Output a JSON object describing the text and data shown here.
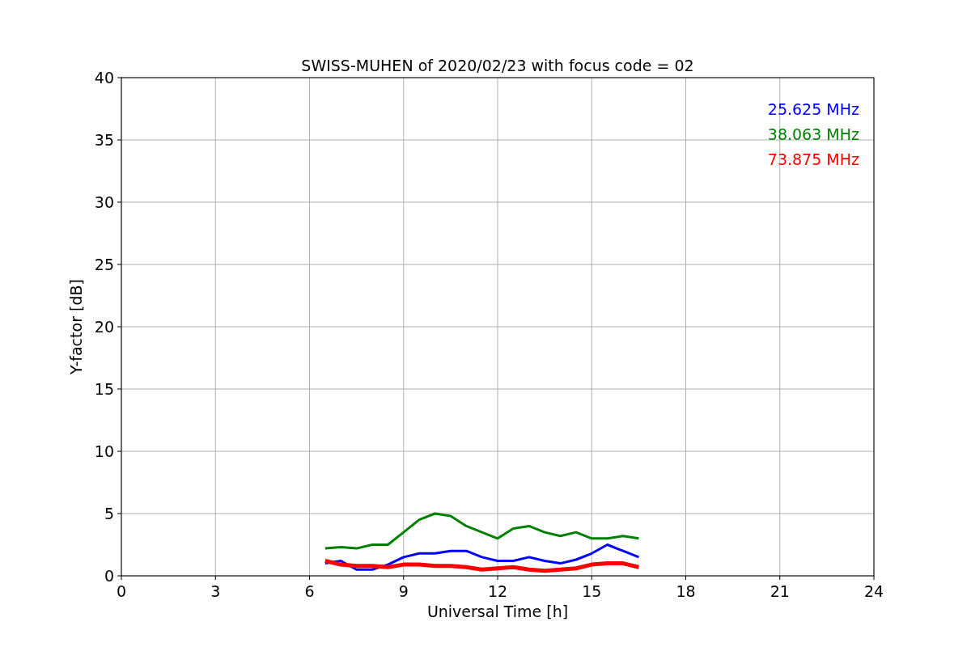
{
  "figure": {
    "chart_data": {
      "type": "line",
      "title": "SWISS-MUHEN of 2020/02/23 with focus code = 02",
      "xlabel": "Universal Time [h]",
      "ylabel": "Y-factor [dB]",
      "x": [
        6.5,
        7,
        7.5,
        8,
        8.5,
        9,
        9.5,
        10,
        10.5,
        11,
        11.5,
        12,
        12.5,
        13,
        13.5,
        14,
        14.5,
        15,
        15.5,
        16,
        16.5
      ],
      "series": [
        {
          "name": "25.625 MHz",
          "color": "#0000ff",
          "values": [
            1.0,
            1.2,
            0.5,
            0.5,
            0.9,
            1.5,
            1.8,
            1.8,
            2.0,
            2.0,
            1.5,
            1.2,
            1.2,
            1.5,
            1.2,
            1.0,
            1.3,
            1.8,
            2.5,
            2.0,
            1.5
          ]
        },
        {
          "name": "38.063 MHz",
          "color": "#008000",
          "values": [
            2.2,
            2.3,
            2.2,
            2.5,
            2.5,
            3.5,
            4.5,
            5.0,
            4.8,
            4.0,
            3.5,
            3.0,
            3.8,
            4.0,
            3.5,
            3.2,
            3.5,
            3.0,
            3.0,
            3.2,
            3.0
          ]
        },
        {
          "name": "73.875 MHz",
          "color": "#ff0000",
          "values": [
            1.2,
            0.9,
            0.8,
            0.8,
            0.7,
            0.9,
            0.9,
            0.8,
            0.8,
            0.7,
            0.5,
            0.6,
            0.7,
            0.5,
            0.4,
            0.5,
            0.6,
            0.9,
            1.0,
            1.0,
            0.7
          ]
        }
      ],
      "xlim": [
        0,
        24
      ],
      "ylim": [
        0,
        40
      ],
      "xticks": [
        0,
        3,
        6,
        9,
        12,
        15,
        18,
        21,
        24
      ],
      "yticks": [
        0,
        5,
        10,
        15,
        20,
        25,
        30,
        35,
        40
      ],
      "grid": true
    }
  }
}
